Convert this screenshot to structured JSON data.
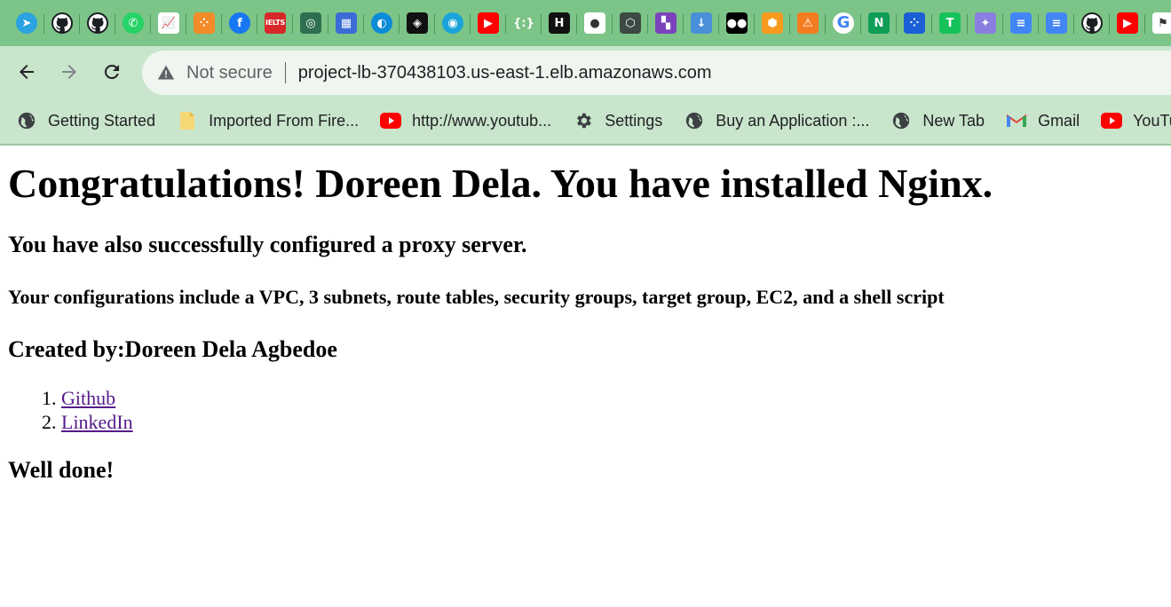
{
  "tabs": [
    {
      "icon": "telegram-icon",
      "bg": "#2aa3e0",
      "glyph": "➤",
      "round": true
    },
    {
      "icon": "github-icon",
      "bg": "#1b1f23",
      "glyph": "",
      "round": true
    },
    {
      "icon": "github-icon",
      "bg": "#1b1f23",
      "glyph": "",
      "round": true
    },
    {
      "icon": "whatsapp-icon",
      "bg": "#25d366",
      "glyph": "✆",
      "round": true
    },
    {
      "icon": "chart-app-icon",
      "bg": "#ffffff",
      "glyph": "📈",
      "round": false
    },
    {
      "icon": "dots-app-icon",
      "bg": "#f28c28",
      "glyph": "⁘",
      "round": false
    },
    {
      "icon": "facebook-icon",
      "bg": "#1877f2",
      "glyph": "f",
      "round": true
    },
    {
      "icon": "ielts-icon",
      "bg": "#d62828",
      "glyph": "IELTS",
      "round": false
    },
    {
      "icon": "education-icon",
      "bg": "#2f6f4f",
      "glyph": "◎",
      "round": false
    },
    {
      "icon": "dashboard-icon",
      "bg": "#3b6bd6",
      "glyph": "▦",
      "round": false
    },
    {
      "icon": "edge-icon",
      "bg": "#0c8bd8",
      "glyph": "◐",
      "round": true
    },
    {
      "icon": "dark-app-icon",
      "bg": "#111111",
      "glyph": "◈",
      "round": false
    },
    {
      "icon": "circle-app-icon",
      "bg": "#1aa3d9",
      "glyph": "◉",
      "round": true
    },
    {
      "icon": "youtube-icon",
      "bg": "#ff0000",
      "glyph": "▶",
      "round": false
    },
    {
      "icon": "code-bracket-icon",
      "bg": "#7cc487",
      "glyph": "{:}",
      "round": false
    },
    {
      "icon": "hashicorp-icon",
      "bg": "#111111",
      "glyph": "H",
      "round": false
    },
    {
      "icon": "ninja-icon",
      "bg": "#ffffff",
      "glyph": "●",
      "round": false
    },
    {
      "icon": "hexagon-icon",
      "bg": "#3c4a44",
      "glyph": "⬡",
      "round": false
    },
    {
      "icon": "terraform-icon",
      "bg": "#7b42bc",
      "glyph": "▚",
      "round": false
    },
    {
      "icon": "download-icon",
      "bg": "#4a90d9",
      "glyph": "↓",
      "round": false
    },
    {
      "icon": "medium-icon",
      "bg": "#000000",
      "glyph": "●●",
      "round": false
    },
    {
      "icon": "box-icon",
      "bg": "#f79a1e",
      "glyph": "⬢",
      "round": false
    },
    {
      "icon": "network-icon",
      "bg": "#f47c20",
      "glyph": "⚠",
      "round": false
    },
    {
      "icon": "google-icon",
      "bg": "#ffffff",
      "glyph": "G",
      "round": true
    },
    {
      "icon": "n-app-icon",
      "bg": "#0f9d58",
      "glyph": "N",
      "round": false
    },
    {
      "icon": "grid-app-icon",
      "bg": "#1a5fd6",
      "glyph": "⁘",
      "round": false
    },
    {
      "icon": "green-t-icon",
      "bg": "#16c25a",
      "glyph": "T",
      "round": false
    },
    {
      "icon": "sparkle-icon",
      "bg": "#8a7fe0",
      "glyph": "✦",
      "round": false
    },
    {
      "icon": "google-docs-icon",
      "bg": "#4285f4",
      "glyph": "≡",
      "round": false
    },
    {
      "icon": "google-docs-icon",
      "bg": "#4285f4",
      "glyph": "≡",
      "round": false
    },
    {
      "icon": "github-icon",
      "bg": "#1b1f23",
      "glyph": "",
      "round": true
    },
    {
      "icon": "youtube-icon",
      "bg": "#ff0000",
      "glyph": "▶",
      "round": false
    },
    {
      "icon": "flag-app-icon",
      "bg": "#ffffff",
      "glyph": "⚑",
      "round": false
    }
  ],
  "toolbar": {
    "security_label": "Not secure",
    "url": "project-lb-370438103.us-east-1.elb.amazonaws.com"
  },
  "bookmarks": [
    {
      "label": "Getting Started",
      "icon": "globe-icon"
    },
    {
      "label": "Imported From Fire...",
      "icon": "folder-icon"
    },
    {
      "label": "http://www.youtub...",
      "icon": "youtube-icon"
    },
    {
      "label": "Settings",
      "icon": "gear-icon"
    },
    {
      "label": "Buy an Application :...",
      "icon": "globe-icon"
    },
    {
      "label": "New Tab",
      "icon": "globe-icon"
    },
    {
      "label": "Gmail",
      "icon": "gmail-icon"
    },
    {
      "label": "YouTu",
      "icon": "youtube-icon"
    }
  ],
  "page": {
    "heading": "Congratulations! Doreen Dela. You have installed Nginx.",
    "proxy_msg": "You have also successfully configured a proxy server.",
    "config_msg": "Your configurations include a VPC, 3 subnets, route tables, security groups, target group, EC2, and a shell script",
    "created_by": "Created by:Doreen Dela Agbedoe",
    "links": [
      {
        "label": "Github"
      },
      {
        "label": "LinkedIn"
      }
    ],
    "footer": "Well done!"
  }
}
